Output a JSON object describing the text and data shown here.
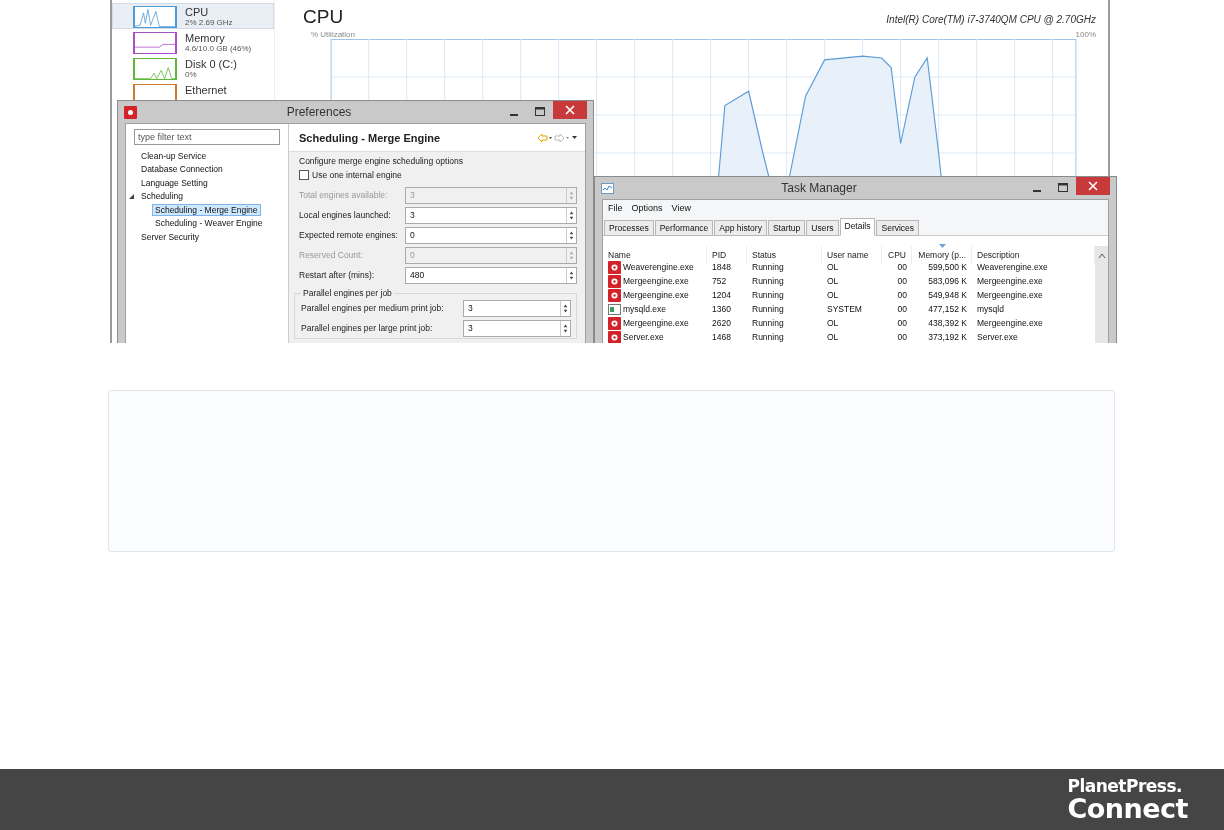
{
  "performance_pane": {
    "sidebar": [
      {
        "name": "CPU",
        "detail": "2% 2.69 GHz",
        "selected": true,
        "color": "#4a9bd6"
      },
      {
        "name": "Memory",
        "detail": "4.6/10.0 GB (46%)",
        "selected": false,
        "color": "#a94fc7"
      },
      {
        "name": "Disk 0 (C:)",
        "detail": "0%",
        "selected": false,
        "color": "#5fb83a"
      },
      {
        "name": "Ethernet",
        "selected": false,
        "color": "#c97a2e"
      }
    ],
    "title": "CPU",
    "processor": "Intel(R) Core(TM) i7-3740QM CPU @ 2.70GHz",
    "axis_label": "% Utilization",
    "axis_max": "100%"
  },
  "preferences": {
    "title": "Preferences",
    "filter": {
      "placeholder": "type filter text"
    },
    "tree": [
      {
        "label": "Clean-up Service",
        "selected": false
      },
      {
        "label": "Database Connection",
        "selected": false
      },
      {
        "label": "Language Setting",
        "selected": false
      },
      {
        "label": "Scheduling",
        "selected": false,
        "expanded": true,
        "children": [
          {
            "label": "Scheduling - Merge Engine",
            "selected": true
          },
          {
            "label": "Scheduling - Weaver Engine",
            "selected": false
          }
        ]
      },
      {
        "label": "Server Security",
        "selected": false
      }
    ],
    "page_title": "Scheduling - Merge Engine",
    "description": "Configure merge engine scheduling options",
    "fields": [
      {
        "kind": "checkbox",
        "label": "Use one internal engine",
        "checked": false
      },
      {
        "kind": "spinner",
        "label": "Total engines available:",
        "value": "3",
        "disabled": true
      },
      {
        "kind": "spinner",
        "label": "Local engines launched:",
        "value": "3",
        "disabled": false
      },
      {
        "kind": "spinner",
        "label": "Expected remote engines:",
        "value": "0",
        "disabled": false
      },
      {
        "kind": "spinner",
        "label": "Reserved Count:",
        "value": "0",
        "disabled": true
      },
      {
        "kind": "spinner",
        "label": "Restart after (mins):",
        "value": "480",
        "disabled": false
      }
    ],
    "group": {
      "title": "Parallel engines per job",
      "fields": [
        {
          "label": "Parallel engines per medium print job:",
          "value": "3"
        },
        {
          "label": "Parallel engines per large print job:",
          "value": "3"
        }
      ]
    }
  },
  "task_manager": {
    "title": "Task Manager",
    "menu": [
      "File",
      "Options",
      "View"
    ],
    "tabs": [
      {
        "label": "Processes",
        "selected": false
      },
      {
        "label": "Performance",
        "selected": false
      },
      {
        "label": "App history",
        "selected": false
      },
      {
        "label": "Startup",
        "selected": false
      },
      {
        "label": "Users",
        "selected": false
      },
      {
        "label": "Details",
        "selected": true
      },
      {
        "label": "Services",
        "selected": false
      }
    ],
    "columns": [
      {
        "label": "Name",
        "sorted": false
      },
      {
        "label": "PID",
        "sorted": false
      },
      {
        "label": "Status",
        "sorted": false
      },
      {
        "label": "User name",
        "sorted": false
      },
      {
        "label": "CPU",
        "sorted": false
      },
      {
        "label": "Memory (p...",
        "sorted": true
      },
      {
        "label": "Description",
        "sorted": false
      }
    ],
    "rows": [
      {
        "kind": "app",
        "cells": [
          "Weaverengine.exe",
          "1848",
          "Running",
          "OL",
          "00",
          "599,500 K",
          "Weaverengine.exe"
        ]
      },
      {
        "kind": "app",
        "cells": [
          "Mergeengine.exe",
          "752",
          "Running",
          "OL",
          "00",
          "583,096 K",
          "Mergeengine.exe"
        ]
      },
      {
        "kind": "app",
        "cells": [
          "Mergeengine.exe",
          "1204",
          "Running",
          "OL",
          "00",
          "549,948 K",
          "Mergeengine.exe"
        ]
      },
      {
        "kind": "database",
        "cells": [
          "mysqld.exe",
          "1360",
          "Running",
          "SYSTEM",
          "00",
          "477,152 K",
          "mysqld"
        ]
      },
      {
        "kind": "app",
        "cells": [
          "Mergeengine.exe",
          "2620",
          "Running",
          "OL",
          "00",
          "438,392 K",
          "Mergeengine.exe"
        ]
      },
      {
        "kind": "app",
        "cells": [
          "Server.exe",
          "1468",
          "Running",
          "OL",
          "00",
          "373,192 K",
          "Server.exe"
        ]
      }
    ]
  },
  "footer": {
    "brand_top": "PlanetPress.",
    "brand_bottom": "Connect"
  }
}
